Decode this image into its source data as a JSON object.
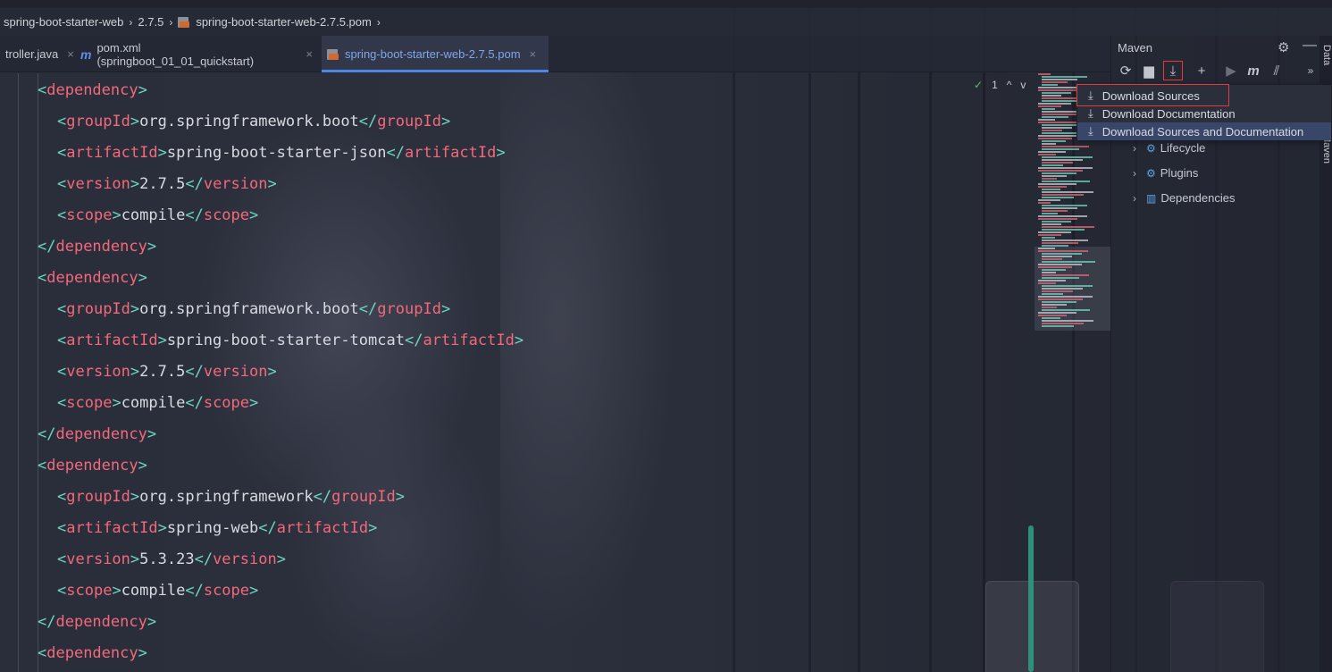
{
  "breadcrumb": {
    "items": [
      "spring-boot-starter-web",
      "2.7.5",
      "spring-boot-starter-web-2.7.5.pom"
    ],
    "separator": "›"
  },
  "tabs": [
    {
      "label": "troller.java",
      "close": "×",
      "active": false
    },
    {
      "label": "pom.xml (springboot_01_01_quickstart)",
      "icon": "m",
      "close": "×",
      "active": false
    },
    {
      "label": "spring-boot-starter-web-2.7.5.pom",
      "close": "×",
      "active": true
    }
  ],
  "inspection": {
    "count": "1",
    "up": "^",
    "down": "v"
  },
  "code_lines": [
    {
      "indent": 0,
      "open": "<",
      "name": "dependency",
      "close": ">",
      "text": "",
      "end": ""
    },
    {
      "indent": 1,
      "open": "<",
      "name": "groupId",
      "close": ">",
      "text": "org.springframework.boot",
      "end": "groupId"
    },
    {
      "indent": 1,
      "open": "<",
      "name": "artifactId",
      "close": ">",
      "text": "spring-boot-starter-json",
      "end": "artifactId"
    },
    {
      "indent": 1,
      "open": "<",
      "name": "version",
      "close": ">",
      "text": "2.7.5",
      "end": "version"
    },
    {
      "indent": 1,
      "open": "<",
      "name": "scope",
      "close": ">",
      "text": "compile",
      "end": "scope"
    },
    {
      "indent": 0,
      "open": "</",
      "name": "dependency",
      "close": ">",
      "text": "",
      "end": ""
    },
    {
      "indent": 0,
      "open": "<",
      "name": "dependency",
      "close": ">",
      "text": "",
      "end": ""
    },
    {
      "indent": 1,
      "open": "<",
      "name": "groupId",
      "close": ">",
      "text": "org.springframework.boot",
      "end": "groupId"
    },
    {
      "indent": 1,
      "open": "<",
      "name": "artifactId",
      "close": ">",
      "text": "spring-boot-starter-tomcat",
      "end": "artifactId"
    },
    {
      "indent": 1,
      "open": "<",
      "name": "version",
      "close": ">",
      "text": "2.7.5",
      "end": "version"
    },
    {
      "indent": 1,
      "open": "<",
      "name": "scope",
      "close": ">",
      "text": "compile",
      "end": "scope"
    },
    {
      "indent": 0,
      "open": "</",
      "name": "dependency",
      "close": ">",
      "text": "",
      "end": ""
    },
    {
      "indent": 0,
      "open": "<",
      "name": "dependency",
      "close": ">",
      "text": "",
      "end": ""
    },
    {
      "indent": 1,
      "open": "<",
      "name": "groupId",
      "close": ">",
      "text": "org.springframework",
      "end": "groupId"
    },
    {
      "indent": 1,
      "open": "<",
      "name": "artifactId",
      "close": ">",
      "text": "spring-web",
      "end": "artifactId"
    },
    {
      "indent": 1,
      "open": "<",
      "name": "version",
      "close": ">",
      "text": "5.3.23",
      "end": "version"
    },
    {
      "indent": 1,
      "open": "<",
      "name": "scope",
      "close": ">",
      "text": "compile",
      "end": "scope"
    },
    {
      "indent": 0,
      "open": "</",
      "name": "dependency",
      "close": ">",
      "text": "",
      "end": ""
    },
    {
      "indent": 0,
      "open": "<",
      "name": "dependency",
      "close": ">",
      "text": "",
      "end": ""
    }
  ],
  "maven": {
    "title": "Maven",
    "toolbar": [
      {
        "name": "reload-icon",
        "glyph": "⟳"
      },
      {
        "name": "generate-sources-icon",
        "glyph": "▆"
      },
      {
        "name": "download-icon",
        "glyph": "⤓"
      },
      {
        "name": "add-icon",
        "glyph": "+"
      },
      {
        "name": "run-icon",
        "glyph": "▶"
      },
      {
        "name": "maven-goal-icon",
        "glyph": "m"
      },
      {
        "name": "skip-tests-icon",
        "glyph": "⫽"
      },
      {
        "name": "more-icon",
        "glyph": "»"
      }
    ],
    "tree": [
      "Lifecycle",
      "Plugins",
      "Dependencies"
    ],
    "menu": [
      "Download Sources",
      "Download Documentation",
      "Download Sources and Documentation"
    ]
  },
  "side_labels": [
    "Data",
    "Maven"
  ],
  "colors": {
    "tag": "#f2697a",
    "bracket": "#6fd4c0",
    "text": "#d7dae0",
    "accent": "#4e85e2",
    "highlight_box": "#e03c3c",
    "menu_selected": "#384669"
  }
}
